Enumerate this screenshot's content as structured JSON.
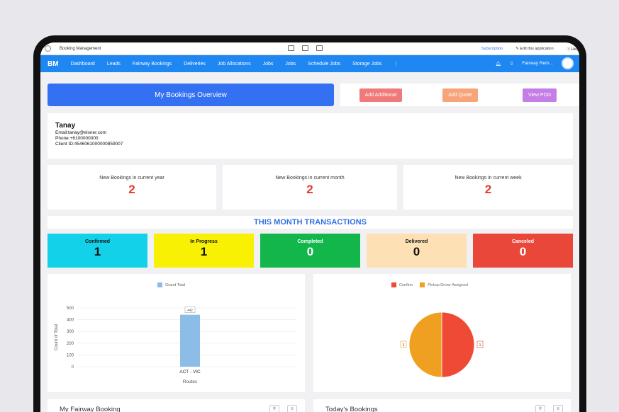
{
  "window": {
    "title": "Booking Management",
    "subscription": "Subscription",
    "edit_app": "Edit this application",
    "help": "Help"
  },
  "nav": {
    "logo": "BM",
    "items": [
      "Dashboard",
      "Leads",
      "Fairway Bookings",
      "Deliveries",
      "Job Allocations",
      "Jobs",
      "Jobs",
      "Schedule Jobs",
      "Storage Jobs"
    ],
    "more": "⋮",
    "user": "Fairway Rem..."
  },
  "header": {
    "title": "My Bookings Overview",
    "add_additional": "Add Additional",
    "add_quote": "Add Quote",
    "view_pod": "View POD"
  },
  "profile": {
    "name": "Tanay",
    "email": "Email:tanay@elsner.com",
    "phone": "Phone:+6100000000",
    "client_id": "Client ID:4546061000000859007"
  },
  "stats": [
    {
      "label": "New Bookings in current year",
      "value": "2"
    },
    {
      "label": "New Bookings in current month",
      "value": "2"
    },
    {
      "label": "New Bookings in current week",
      "value": "2"
    }
  ],
  "transactions": {
    "title": "THIS MONTH TRANSACTIONS",
    "items": [
      {
        "label": "Confirmed",
        "value": "1",
        "color": "#12d1e8"
      },
      {
        "label": "In Progress",
        "value": "1",
        "color": "#f9f104"
      },
      {
        "label": "Completed",
        "value": "0",
        "color": "#13b64a"
      },
      {
        "label": "Delivered",
        "value": "0",
        "color": "#fde1b5"
      },
      {
        "label": "Canceled",
        "value": "0",
        "color": "#e8473a"
      }
    ]
  },
  "chart_data": [
    {
      "type": "bar",
      "categories": [
        "ACT - VIC"
      ],
      "series": [
        {
          "name": "Grand Total",
          "values": [
            442
          ],
          "color": "#8bbde6"
        }
      ],
      "data_labels": [
        "442"
      ],
      "xlabel": "Routes",
      "ylabel": "Count of Total",
      "ylim": [
        0,
        500
      ],
      "yticks": [
        "0",
        "100",
        "200",
        "300",
        "400",
        "500"
      ],
      "grid": true,
      "legend": "top"
    },
    {
      "type": "pie",
      "slices": [
        {
          "name": "Confirm",
          "value": 1,
          "color": "#ee4a36"
        },
        {
          "name": "Pickup Driver Assigned",
          "value": 1,
          "color": "#f0a020"
        }
      ],
      "data_labels": [
        "1",
        "1"
      ],
      "legend": "top"
    }
  ],
  "bottom": {
    "left_title": "My Fairway Booking",
    "right_title": "Today's Bookings"
  }
}
